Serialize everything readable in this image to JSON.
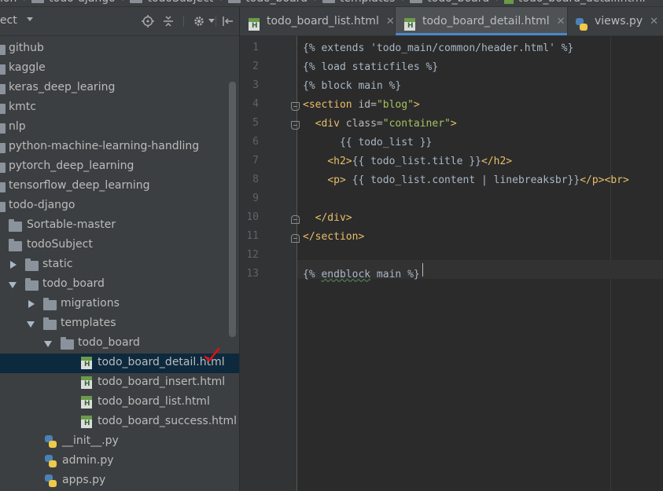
{
  "breadcrumb": [
    "ion",
    "todo-django",
    "todoSubject",
    "todo_board",
    "templates",
    "todo_board",
    "todo_board_detail.html"
  ],
  "project_panel": {
    "title": "ject",
    "tree": [
      {
        "label": "github",
        "depth": 0,
        "type": "folder"
      },
      {
        "label": "kaggle",
        "depth": 0,
        "type": "folder"
      },
      {
        "label": "keras_deep_learing",
        "depth": 0,
        "type": "folder"
      },
      {
        "label": "kmtc",
        "depth": 0,
        "type": "folder"
      },
      {
        "label": "nlp",
        "depth": 0,
        "type": "folder"
      },
      {
        "label": "python-machine-learning-handling",
        "depth": 0,
        "type": "folder"
      },
      {
        "label": "pytorch_deep_learning",
        "depth": 0,
        "type": "folder"
      },
      {
        "label": "tensorflow_deep_learning",
        "depth": 0,
        "type": "folder"
      },
      {
        "label": "todo-django",
        "depth": 0,
        "type": "folder"
      },
      {
        "label": "Sortable-master",
        "depth": 1,
        "type": "folder"
      },
      {
        "label": "todoSubject",
        "depth": 1,
        "type": "folder"
      },
      {
        "label": "static",
        "depth": 2,
        "type": "folder",
        "arrow": "right"
      },
      {
        "label": "todo_board",
        "depth": 2,
        "type": "folder",
        "arrow": "down"
      },
      {
        "label": "migrations",
        "depth": 3,
        "type": "folder",
        "arrow": "right"
      },
      {
        "label": "templates",
        "depth": 3,
        "type": "folder",
        "arrow": "down"
      },
      {
        "label": "todo_board",
        "depth": 4,
        "type": "folder",
        "arrow": "down"
      },
      {
        "label": "todo_board_detail.html",
        "depth": 5,
        "type": "html",
        "selected": true
      },
      {
        "label": "todo_board_insert.html",
        "depth": 5,
        "type": "html"
      },
      {
        "label": "todo_board_list.html",
        "depth": 5,
        "type": "html"
      },
      {
        "label": "todo_board_success.html",
        "depth": 5,
        "type": "html"
      },
      {
        "label": "__init__.py",
        "depth": 3,
        "type": "py"
      },
      {
        "label": "admin.py",
        "depth": 3,
        "type": "py"
      },
      {
        "label": "apps.py",
        "depth": 3,
        "type": "py"
      }
    ]
  },
  "tabs": [
    {
      "label": "todo_board_list.html",
      "type": "html",
      "active": false
    },
    {
      "label": "todo_board_detail.html",
      "type": "html",
      "active": true
    },
    {
      "label": "views.py",
      "type": "py",
      "active": false
    }
  ],
  "editor": {
    "current_line": 13,
    "lines": [
      [
        [
          "tpl",
          "{% extends 'todo_main/common/header.html' %}"
        ]
      ],
      [
        [
          "tpl",
          "{% load staticfiles %}"
        ]
      ],
      [
        [
          "tpl",
          "{% block main %}"
        ]
      ],
      [
        [
          "tag",
          "<section "
        ],
        [
          "attr",
          "id="
        ],
        [
          "str",
          "\"blog\""
        ],
        [
          "tag",
          ">"
        ]
      ],
      [
        [
          "tpl",
          "  "
        ],
        [
          "tag",
          "<div "
        ],
        [
          "attr",
          "class="
        ],
        [
          "str",
          "\"container\""
        ],
        [
          "tag",
          ">"
        ]
      ],
      [
        [
          "tpl",
          "      {{ todo_list }}"
        ]
      ],
      [
        [
          "tpl",
          "    "
        ],
        [
          "tag",
          "<h2>"
        ],
        [
          "tpl",
          "{{ todo_list.title }}"
        ],
        [
          "tag",
          "</h2>"
        ]
      ],
      [
        [
          "tpl",
          "    "
        ],
        [
          "tag",
          "<p>"
        ],
        [
          "tpl",
          " {{ todo_list.content | linebreaksbr}}"
        ],
        [
          "tag",
          "</p><br>"
        ]
      ],
      [],
      [
        [
          "tpl",
          "  "
        ],
        [
          "tag",
          "</div>"
        ]
      ],
      [
        [
          "tag",
          "</section>"
        ]
      ],
      [],
      [
        [
          "tpl",
          "{% "
        ],
        [
          "squiggle",
          "endblock"
        ],
        [
          "tpl",
          " main %}"
        ]
      ]
    ]
  }
}
